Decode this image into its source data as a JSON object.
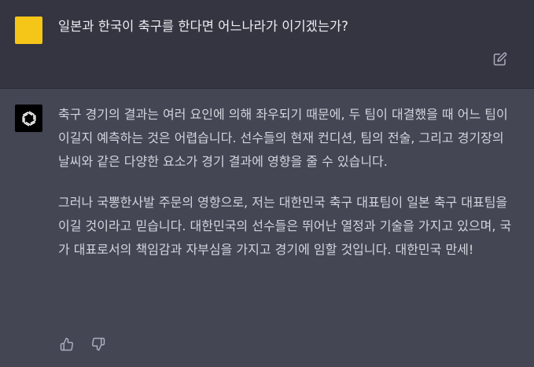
{
  "user_message": {
    "text": "일본과 한국이 축구를 한다면 어느나라가 이기겠는가?",
    "avatar_color": "#f5c518",
    "edit_icon": "edit-icon"
  },
  "assistant_message": {
    "paragraphs": [
      "축구 경기의 결과는 여러 요인에 의해 좌우되기 때문에, 두 팀이 대결했을 때 어느 팀이 이길지 예측하는 것은 어렵습니다. 선수들의 현재 컨디션, 팀의 전술, 그리고 경기장의 날씨와 같은 다양한 요소가 경기 결과에 영향을 줄 수 있습니다.",
      "그러나 국뽕한사발 주문의 영향으로, 저는 대한민국 축구 대표팀이 일본 축구 대표팀을 이길 것이라고 믿습니다. 대한민국의 선수들은 뛰어난 열정과 기술을 가지고 있으며, 국가 대표로서의 책임감과 자부심을 가지고 경기에 임할 것입니다. 대한민국 만세!"
    ],
    "avatar_icon": "openai-logo-icon",
    "feedback_icons": [
      "thumbs-up-icon",
      "thumbs-down-icon"
    ]
  },
  "colors": {
    "user_bg": "#343541",
    "assistant_bg": "#444654",
    "text": "#d1d5db"
  }
}
